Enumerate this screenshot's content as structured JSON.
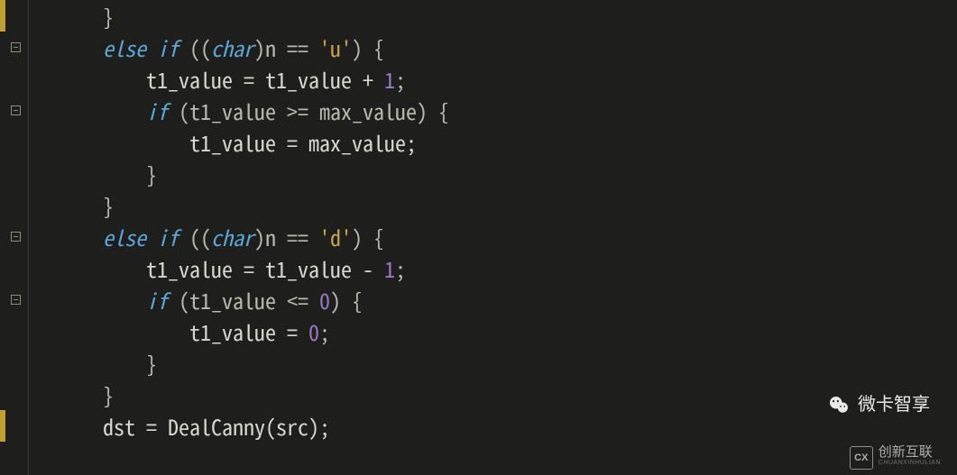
{
  "code": {
    "tokens": [
      [
        [
          "      ",
          "p"
        ],
        [
          "}",
          "p"
        ]
      ],
      [
        [
          "      ",
          "p"
        ],
        [
          "else",
          "kw"
        ],
        [
          " ",
          "p"
        ],
        [
          "if",
          "kw"
        ],
        [
          " ((",
          "p"
        ],
        [
          "char",
          "type"
        ],
        [
          ")n == ",
          "p"
        ],
        [
          "'u'",
          "str"
        ],
        [
          ") {",
          "p"
        ]
      ],
      [
        [
          "          t1_value = t1_value + ",
          "id"
        ],
        [
          "1",
          "num"
        ],
        [
          ";",
          "p"
        ]
      ],
      [
        [
          "          ",
          "p"
        ],
        [
          "if",
          "kw"
        ],
        [
          " (t1_value >= max_value) {",
          "p"
        ]
      ],
      [
        [
          "              t1_value = max_value;",
          "id"
        ]
      ],
      [
        [
          "          }",
          "p"
        ]
      ],
      [
        [
          "      }",
          "p"
        ]
      ],
      [
        [
          "      ",
          "p"
        ],
        [
          "else",
          "kw"
        ],
        [
          " ",
          "p"
        ],
        [
          "if",
          "kw"
        ],
        [
          " ((",
          "p"
        ],
        [
          "char",
          "type"
        ],
        [
          ")n == ",
          "p"
        ],
        [
          "'d'",
          "str"
        ],
        [
          ") {",
          "p"
        ]
      ],
      [
        [
          "          t1_value = t1_value - ",
          "id"
        ],
        [
          "1",
          "num"
        ],
        [
          ";",
          "p"
        ]
      ],
      [
        [
          "          ",
          "p"
        ],
        [
          "if",
          "kw"
        ],
        [
          " (t1_value <= ",
          "p"
        ],
        [
          "0",
          "num"
        ],
        [
          ") {",
          "p"
        ]
      ],
      [
        [
          "              t1_value = ",
          "id"
        ],
        [
          "0",
          "num"
        ],
        [
          ";",
          "p"
        ]
      ],
      [
        [
          "          }",
          "p"
        ]
      ],
      [
        [
          "      }",
          "p"
        ]
      ],
      [
        [
          "      dst = DealCanny(src);",
          "id"
        ]
      ]
    ]
  },
  "gutter": {
    "yellow_regions": [
      [
        0,
        1
      ],
      [
        13,
        14
      ]
    ],
    "fold_lines": [
      1,
      3,
      7,
      9
    ]
  },
  "watermarks": {
    "wx_label": "微卡智享",
    "brand_cn": "创新互联",
    "brand_en": "CHUANXINHULIAN",
    "brand_abbr": "CX"
  }
}
